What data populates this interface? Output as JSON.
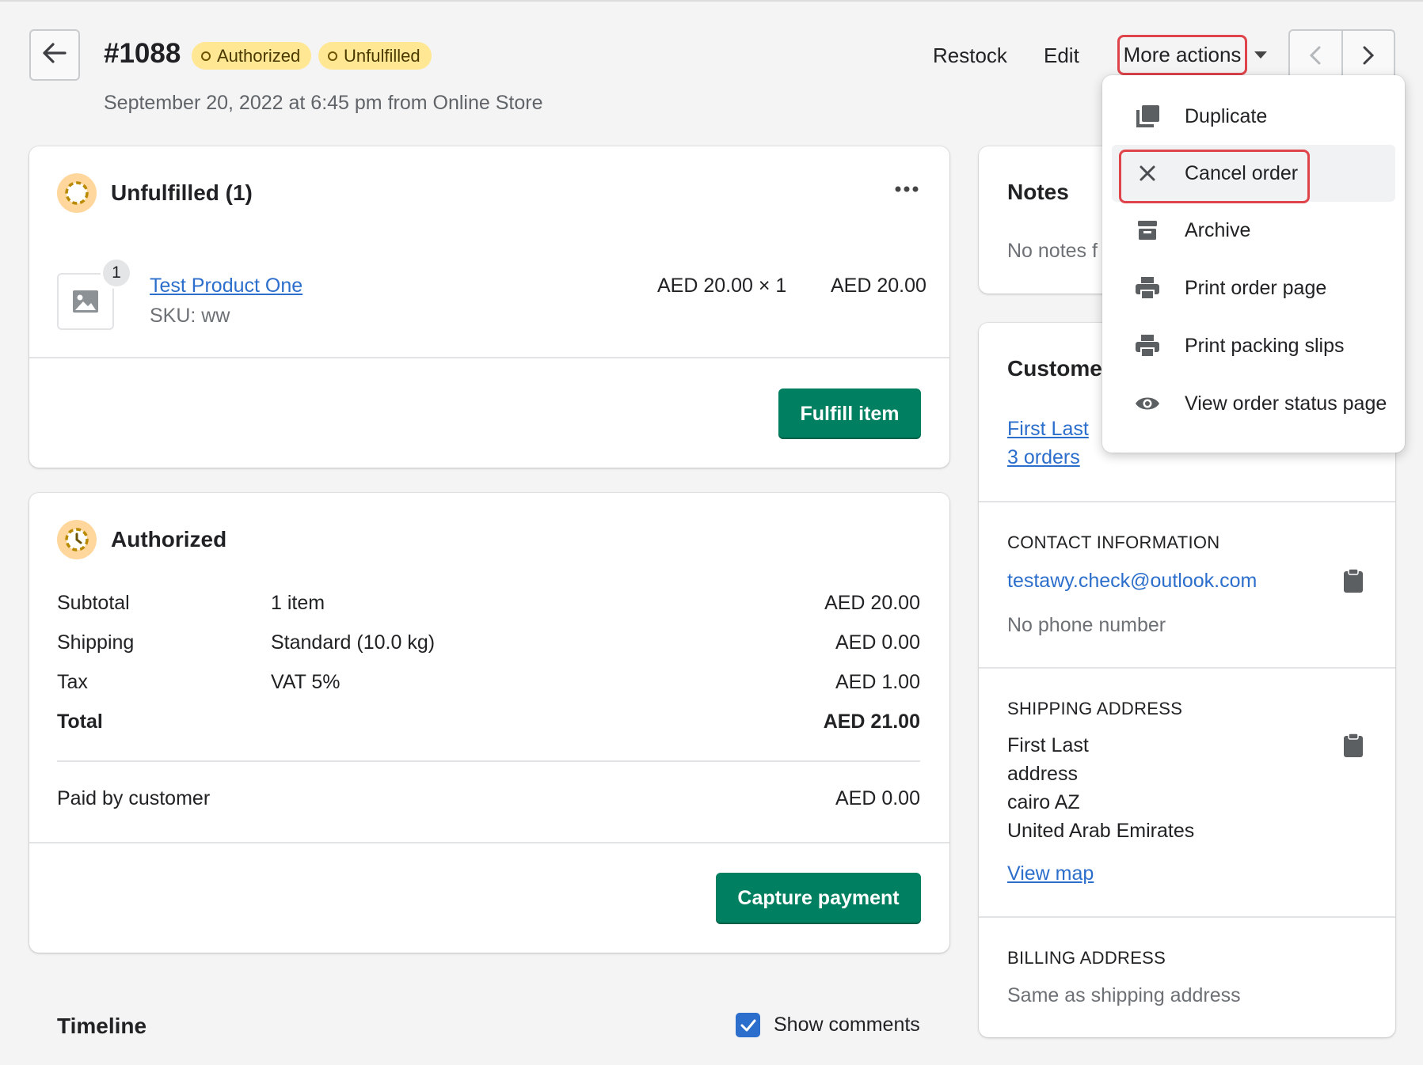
{
  "header": {
    "order_number": "#1088",
    "badges": [
      "Authorized",
      "Unfulfilled"
    ],
    "subtitle": "September 20, 2022 at 6:45 pm from Online Store",
    "restock_label": "Restock",
    "edit_label": "Edit",
    "more_actions_label": "More actions"
  },
  "unfulfilled_card": {
    "title": "Unfulfilled (1)",
    "product": {
      "quantity_badge": "1",
      "name": "Test Product One",
      "sku": "SKU: ww",
      "unit_price": "AED 20.00 × 1",
      "total": "AED 20.00"
    },
    "fulfill_button": "Fulfill item"
  },
  "payment_card": {
    "title": "Authorized",
    "rows": [
      {
        "label": "Subtotal",
        "detail": "1 item",
        "amount": "AED 20.00"
      },
      {
        "label": "Shipping",
        "detail": "Standard (10.0 kg)",
        "amount": "AED 0.00"
      },
      {
        "label": "Tax",
        "detail": "VAT 5%",
        "amount": "AED 1.00"
      },
      {
        "label": "Total",
        "detail": "",
        "amount": "AED 21.00"
      }
    ],
    "paid_label": "Paid by customer",
    "paid_amount": "AED 0.00",
    "capture_button": "Capture payment"
  },
  "timeline": {
    "title": "Timeline",
    "show_comments_label": "Show comments"
  },
  "notes_card": {
    "title": "Notes",
    "text": "No notes f"
  },
  "customer_card": {
    "title": "Custome",
    "name": "First Last",
    "orders": "3 orders",
    "contact_label": "CONTACT INFORMATION",
    "email": "testawy.check@outlook.com",
    "phone": "No phone number",
    "shipping_label": "SHIPPING ADDRESS",
    "shipping_lines": [
      "First Last",
      "address",
      "cairo AZ",
      "United Arab Emirates"
    ],
    "view_map": "View map",
    "billing_label": "BILLING ADDRESS",
    "billing_text": "Same as shipping address"
  },
  "dropdown": {
    "items": [
      {
        "label": "Duplicate",
        "icon": "duplicate-icon"
      },
      {
        "label": "Cancel order",
        "icon": "close-icon"
      },
      {
        "label": "Archive",
        "icon": "archive-icon"
      },
      {
        "label": "Print order page",
        "icon": "printer-icon"
      },
      {
        "label": "Print packing slips",
        "icon": "printer-icon"
      },
      {
        "label": "View order status page",
        "icon": "eye-icon"
      }
    ]
  },
  "colors": {
    "primary_green": "#008060",
    "link_blue": "#2c6ecb",
    "badge_yellow": "#ffe793",
    "highlight_red": "#e0444b"
  }
}
